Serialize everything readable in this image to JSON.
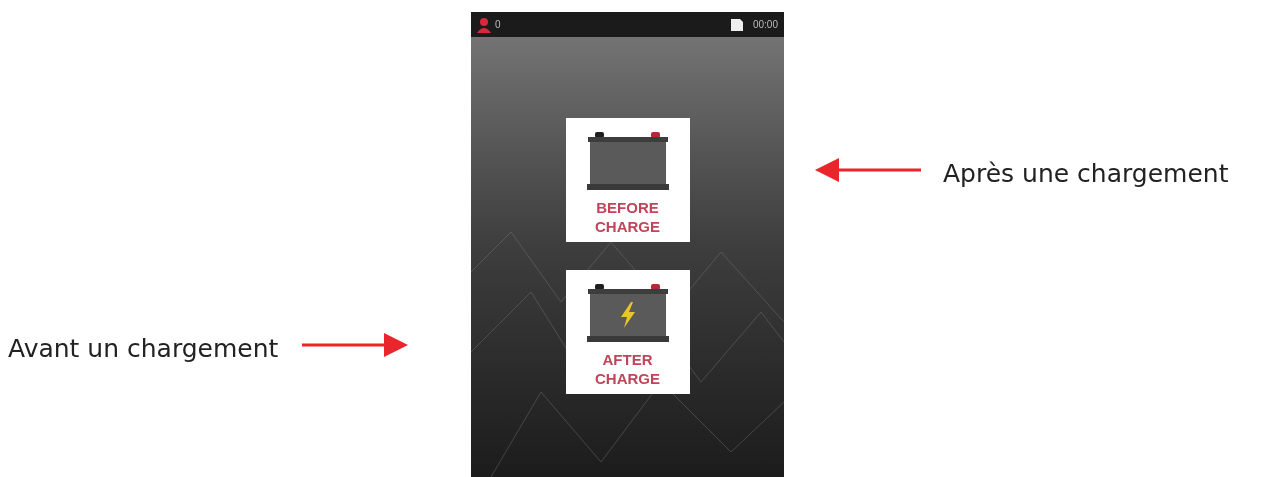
{
  "status_bar": {
    "user_count": "0",
    "time": "00:00"
  },
  "buttons": [
    {
      "lines": [
        "BEFORE",
        "CHARGE"
      ],
      "kind": "plain"
    },
    {
      "lines": [
        "AFTER",
        "CHARGE"
      ],
      "kind": "charging"
    }
  ],
  "annotations": {
    "left": "Avant un chargement",
    "right": "Après une chargement"
  }
}
